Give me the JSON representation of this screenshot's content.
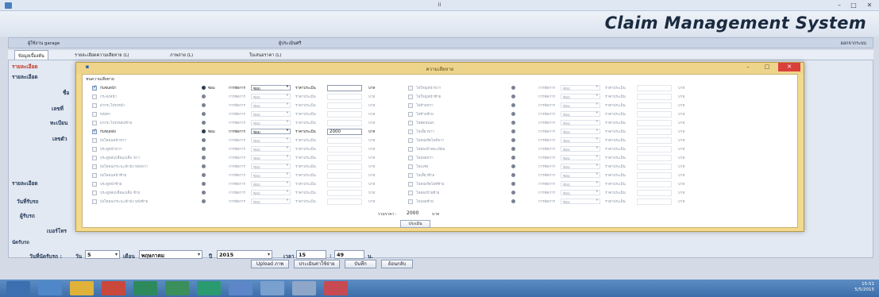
{
  "window": {
    "title": "ii",
    "min": "–",
    "max": "□",
    "close": "✕"
  },
  "header": {
    "brand": "Claim Management System"
  },
  "userbar": {
    "user": "ผู้ใช้งาน garage",
    "role": "ผู้ประเมินศรี",
    "logout": "ออกจากระบบ"
  },
  "tabs": [
    "ข้อมูลเบื้องต้น",
    "รายละเอียดความเสียหาย (L)",
    "ภาพถ่าย (L)",
    "ใบเสนอราคา (L)"
  ],
  "side_labels": [
    "รายละเอียด",
    "ชื่อ",
    "เลขที่",
    "ทะเบียน",
    "เลขตัว",
    "รายละเอียด",
    "วันที่รับรถ",
    "ผู้รับรถ",
    "เบอร์โทร"
  ],
  "bottom": {
    "section": "นัดรับรถ",
    "date_label": "วันที่นัดรับรถ :",
    "day_label": "วัน",
    "day": "5",
    "month_label": "เดือน",
    "month": "พฤษภาคม",
    "year_label": "ปี",
    "year": "2015",
    "time_label": "เวลา",
    "hour": "15",
    "sep": ":",
    "minute": "49",
    "min_unit": "น.",
    "buttons": [
      "Upload ภาพ",
      "ประเมินค่าใช้จ่าย",
      "บันทึก",
      "ย้อนกลับ"
    ]
  },
  "dialog": {
    "title": "ความเสียหาย",
    "legend": "ชนความเสียหาย",
    "left_items": [
      {
        "label": "กันชนหน้า",
        "checked": true,
        "mode": "ซ่อม",
        "price": ""
      },
      {
        "label": "กระจังหน้า",
        "checked": false,
        "mode": "ซ่อม",
        "price": ""
      },
      {
        "label": "ฝากระโปรงหน้า",
        "checked": false,
        "mode": "ซ่อม",
        "price": ""
      },
      {
        "label": "หลังคา",
        "checked": false,
        "mode": "ซ่อม",
        "price": ""
      },
      {
        "label": "ฝากระโปรงหลัง/ท้าย",
        "checked": false,
        "mode": "ซ่อม",
        "price": ""
      },
      {
        "label": "กันชนหลัง",
        "checked": true,
        "mode": "ซ่อม",
        "price": "2000"
      },
      {
        "label": "บังโคลนหน้าขวา",
        "checked": false,
        "mode": "ซ่อม",
        "price": ""
      },
      {
        "label": "ประตูหน้าขวา",
        "checked": false,
        "mode": "ซ่อม",
        "price": ""
      },
      {
        "label": "ประตูหลัง/เลื่อน/แค็บ ขวา",
        "checked": false,
        "mode": "ซ่อม",
        "price": ""
      },
      {
        "label": "บังโคลน/กระบะ/ตัวถัง หลังขวา",
        "checked": false,
        "mode": "ซ่อม",
        "price": ""
      },
      {
        "label": "บังโคลนหน้าซ้าย",
        "checked": false,
        "mode": "ซ่อม",
        "price": ""
      },
      {
        "label": "ประตูหน้าซ้าย",
        "checked": false,
        "mode": "ซ่อม",
        "price": ""
      },
      {
        "label": "ประตูหลัง/เลื่อน/แค็บ ซ้าย",
        "checked": false,
        "mode": "ซ่อม",
        "price": ""
      },
      {
        "label": "บังโคลน/กระบะ/ตัวถัง หลังซ้าย",
        "checked": false,
        "mode": "ซ่อม",
        "price": ""
      }
    ],
    "right_items": [
      "ไฟใหญ่หน้าขวา",
      "ไฟใหญ่หน้าซ้าย",
      "ไฟท้ายขวา",
      "ไฟท้ายซ้าย",
      "ไฟตัดหมอก",
      "ไฟเลี้ยวขวา",
      "ไฟสปอร์ตไลท์ขวา",
      "ไฟส่องป้ายทะเบียน",
      "ไฟถอยขวา",
      "ไฟเบรค",
      "ไฟเลี้ยวซ้าย",
      "ไฟสปอร์ตไลท์ซ้าย",
      "ไฟส่องป้ายซ้าย",
      "ไฟถอยซ้าย"
    ],
    "repair_label": "ซ่อม",
    "method_label": "การจัดการ",
    "price_label": "ราคาประเมิน",
    "unit": "บาท",
    "select_arrow": "▾",
    "total_label": "รวมราคา :",
    "total": "2000",
    "total_unit": "บาท",
    "ok": "ประเมิน"
  },
  "tray": {
    "time": "15:51",
    "date": "5/5/2015"
  }
}
